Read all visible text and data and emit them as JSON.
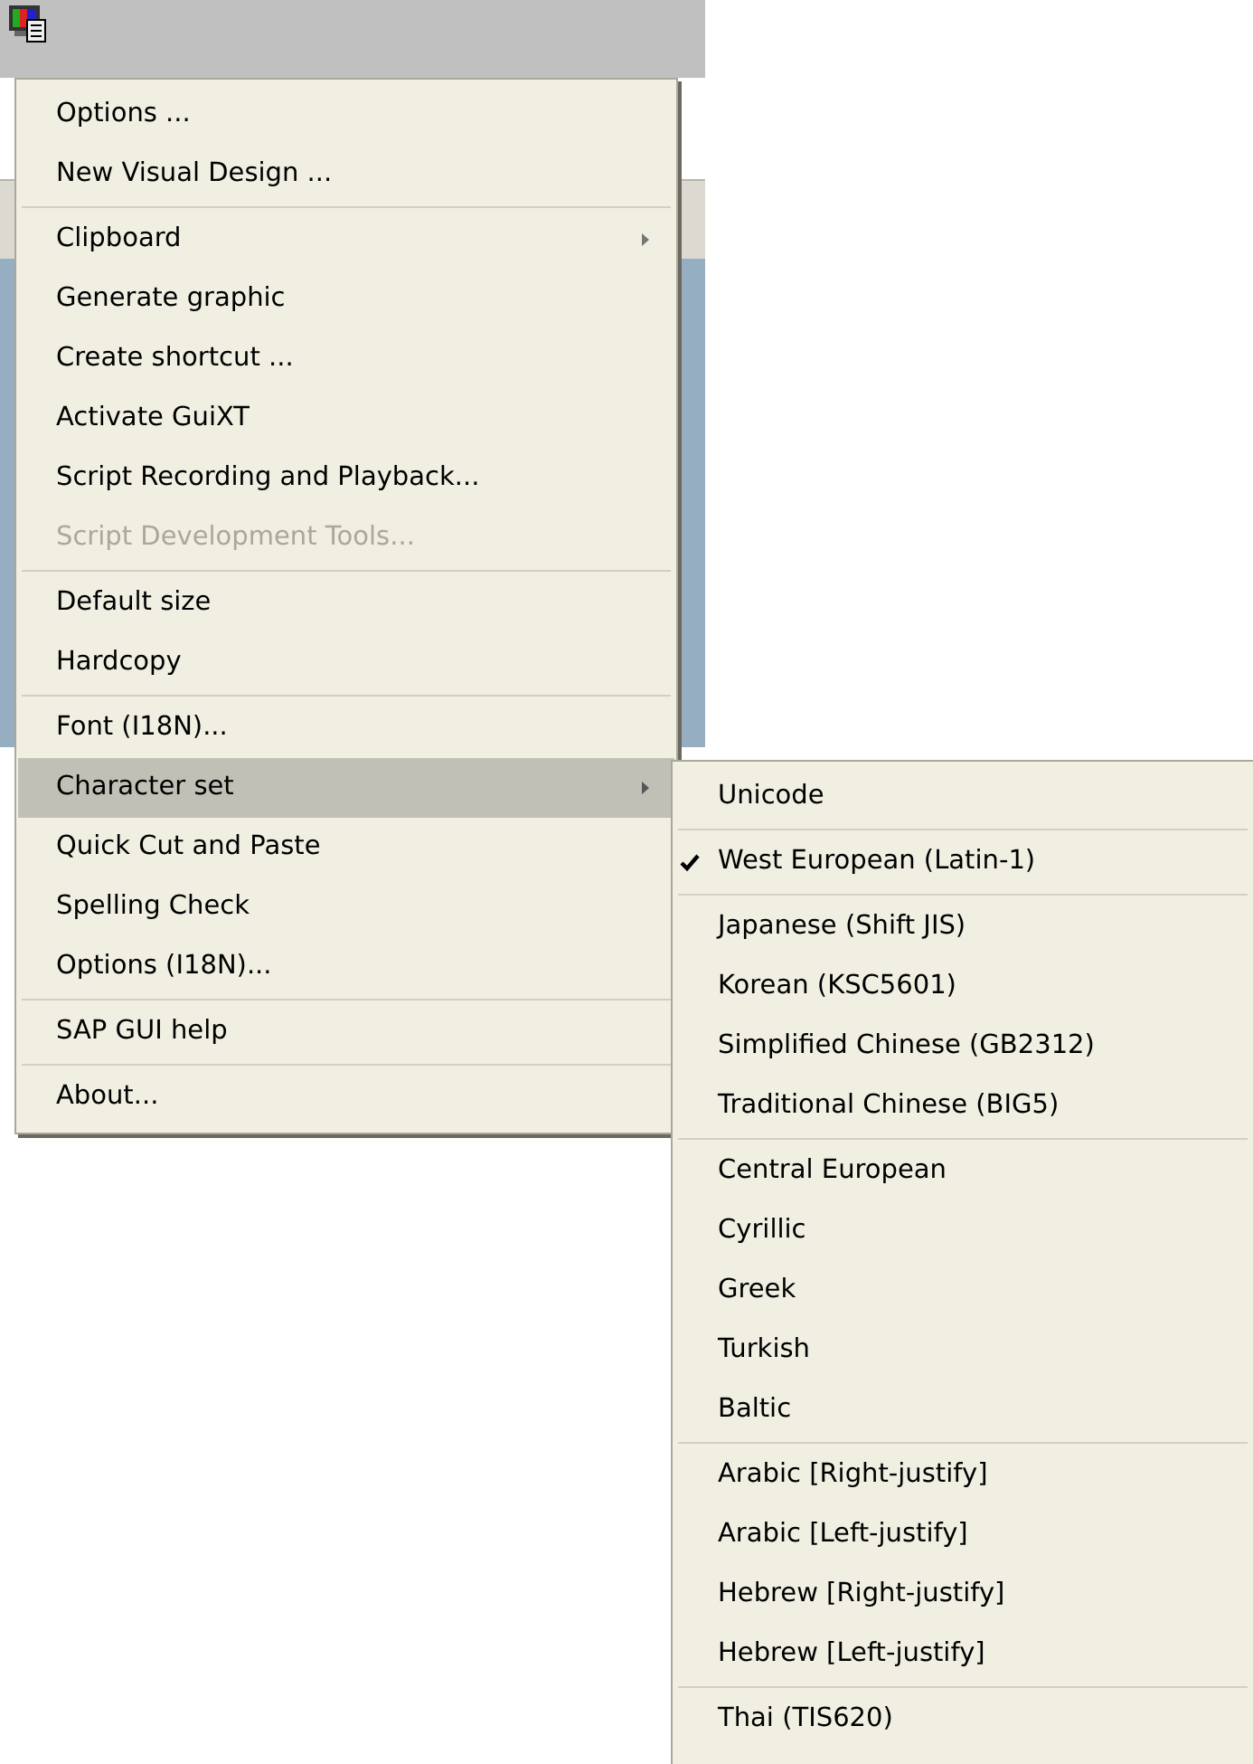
{
  "menu": {
    "groups": [
      {
        "items": [
          {
            "label": "Options ...",
            "disabled": false,
            "selected": false,
            "submenu": false
          },
          {
            "label": "New Visual Design ...",
            "disabled": false,
            "selected": false,
            "submenu": false
          }
        ]
      },
      {
        "items": [
          {
            "label": "Clipboard",
            "disabled": false,
            "selected": false,
            "submenu": true
          },
          {
            "label": "Generate graphic",
            "disabled": false,
            "selected": false,
            "submenu": false
          },
          {
            "label": "Create shortcut ...",
            "disabled": false,
            "selected": false,
            "submenu": false
          },
          {
            "label": "Activate GuiXT",
            "disabled": false,
            "selected": false,
            "submenu": false
          },
          {
            "label": "Script Recording and Playback...",
            "disabled": false,
            "selected": false,
            "submenu": false
          },
          {
            "label": "Script Development Tools...",
            "disabled": true,
            "selected": false,
            "submenu": false
          }
        ]
      },
      {
        "items": [
          {
            "label": "Default size",
            "disabled": false,
            "selected": false,
            "submenu": false
          },
          {
            "label": "Hardcopy",
            "disabled": false,
            "selected": false,
            "submenu": false
          }
        ]
      },
      {
        "items": [
          {
            "label": "Font (I18N)...",
            "disabled": false,
            "selected": false,
            "submenu": false
          },
          {
            "label": "Character set",
            "disabled": false,
            "selected": true,
            "submenu": true
          },
          {
            "label": "Quick Cut and Paste",
            "disabled": false,
            "selected": false,
            "submenu": false
          },
          {
            "label": "Spelling Check",
            "disabled": false,
            "selected": false,
            "submenu": false
          },
          {
            "label": "Options (I18N)...",
            "disabled": false,
            "selected": false,
            "submenu": false
          }
        ]
      },
      {
        "items": [
          {
            "label": "SAP GUI help",
            "disabled": false,
            "selected": false,
            "submenu": false
          }
        ]
      },
      {
        "items": [
          {
            "label": "About...",
            "disabled": false,
            "selected": false,
            "submenu": false
          }
        ]
      }
    ]
  },
  "submenu": {
    "groups": [
      {
        "items": [
          {
            "label": "Unicode",
            "checked": false
          }
        ]
      },
      {
        "items": [
          {
            "label": "West European (Latin-1)",
            "checked": true
          }
        ]
      },
      {
        "items": [
          {
            "label": "Japanese (Shift JIS)",
            "checked": false
          },
          {
            "label": "Korean (KSC5601)",
            "checked": false
          },
          {
            "label": "Simplified Chinese (GB2312)",
            "checked": false
          },
          {
            "label": "Traditional Chinese (BIG5)",
            "checked": false
          }
        ]
      },
      {
        "items": [
          {
            "label": "Central European",
            "checked": false
          },
          {
            "label": "Cyrillic",
            "checked": false
          },
          {
            "label": "Greek",
            "checked": false
          },
          {
            "label": "Turkish",
            "checked": false
          },
          {
            "label": "Baltic",
            "checked": false
          }
        ]
      },
      {
        "items": [
          {
            "label": "Arabic [Right-justify]",
            "checked": false
          },
          {
            "label": "Arabic [Left-justify]",
            "checked": false
          },
          {
            "label": "Hebrew [Right-justify]",
            "checked": false
          },
          {
            "label": "Hebrew [Left-justify]",
            "checked": false
          }
        ]
      },
      {
        "items": [
          {
            "label": "Thai (TIS620)",
            "checked": false
          }
        ]
      }
    ]
  }
}
